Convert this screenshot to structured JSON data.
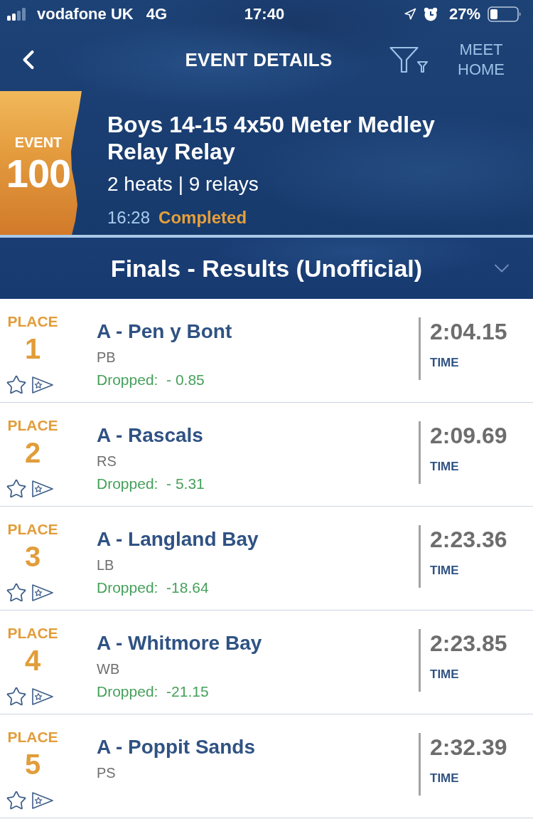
{
  "status_bar": {
    "carrier": "vodafone UK",
    "network": "4G",
    "time": "17:40",
    "battery": "27%"
  },
  "nav": {
    "title": "EVENT DETAILS",
    "meet_home": [
      "MEET",
      "HOME"
    ]
  },
  "event": {
    "label": "EVENT",
    "number": "100",
    "title": "Boys 14-15 4x50 Meter Medley Relay Relay",
    "summary": "2 heats | 9 relays",
    "time": "16:28",
    "status": "Completed"
  },
  "section": {
    "title": "Finals - Results (Unofficial)"
  },
  "results": [
    {
      "place_label": "PLACE",
      "place": "1",
      "team": "A - Pen y Bont",
      "code": "PB",
      "dropped": "Dropped:  - 0.85",
      "time": "2:04.15",
      "time_label": "TIME"
    },
    {
      "place_label": "PLACE",
      "place": "2",
      "team": "A - Rascals",
      "code": "RS",
      "dropped": "Dropped:  - 5.31",
      "time": "2:09.69",
      "time_label": "TIME"
    },
    {
      "place_label": "PLACE",
      "place": "3",
      "team": "A - Langland Bay",
      "code": "LB",
      "dropped": "Dropped:  -18.64",
      "time": "2:23.36",
      "time_label": "TIME"
    },
    {
      "place_label": "PLACE",
      "place": "4",
      "team": "A - Whitmore Bay",
      "code": "WB",
      "dropped": "Dropped:  -21.15",
      "time": "2:23.85",
      "time_label": "TIME"
    },
    {
      "place_label": "PLACE",
      "place": "5",
      "team": "A - Poppit Sands",
      "code": "PS",
      "time": "2:32.39",
      "time_label": "TIME"
    }
  ]
}
